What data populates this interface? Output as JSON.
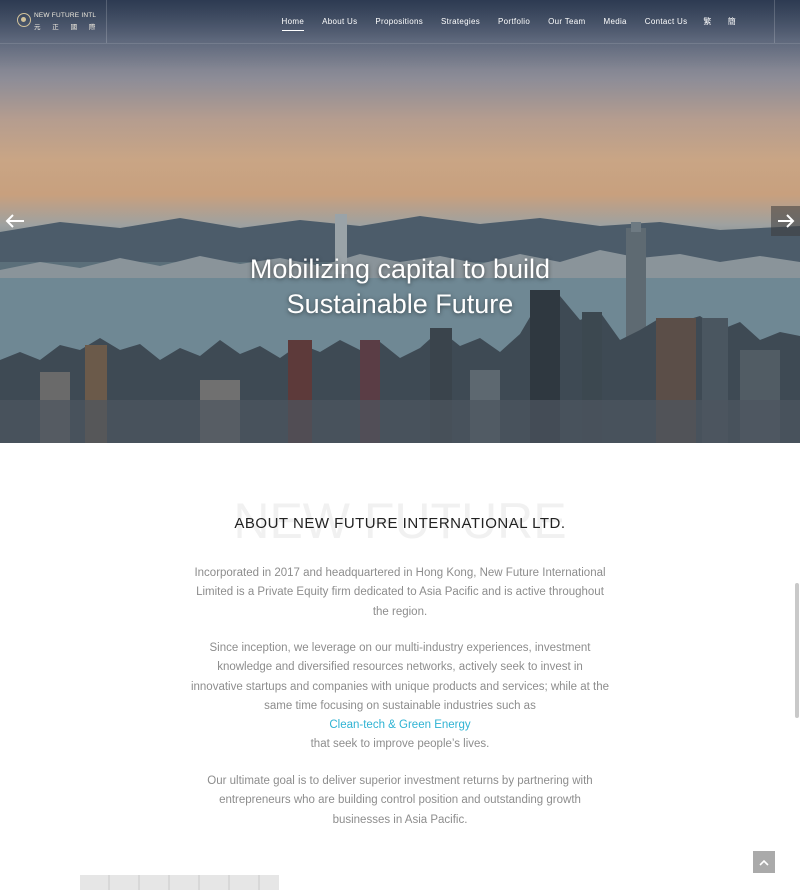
{
  "brand": {
    "name": "NEW FUTURE INTL",
    "name_cn": "元 正 國 際"
  },
  "nav": {
    "items": [
      {
        "label": "Home",
        "active": true
      },
      {
        "label": "About Us"
      },
      {
        "label": "Propositions"
      },
      {
        "label": "Strategies"
      },
      {
        "label": "Portfolio"
      },
      {
        "label": "Our Team"
      },
      {
        "label": "Media"
      },
      {
        "label": "Contact Us"
      },
      {
        "label": "繁"
      },
      {
        "label": "簡"
      }
    ]
  },
  "hero": {
    "title_line1": "Mobilizing capital to build",
    "title_line2": "Sustainable Future",
    "prev_icon": "arrow-left-icon",
    "next_icon": "arrow-right-icon"
  },
  "about": {
    "watermark": "NEW FUTURE",
    "title": "ABOUT NEW FUTURE INTERNATIONAL LTD.",
    "p1": "Incorporated in 2017 and headquartered in Hong Kong, New Future International Limited is a Private Equity firm dedicated to Asia Pacific and is active throughout the region.",
    "p2_a": "Since inception, we leverage on our multi-industry experiences, investment knowledge and diversified resources networks, actively seek to invest in innovative startups and companies with unique products and services; while at the same time focusing on sustainable industries such as",
    "p2_highlight": "Clean-tech & Green Energy",
    "p2_b": "that seek to improve people’s lives.",
    "p3": "Our ultimate goal is to deliver superior investment returns by partnering with entrepreneurs who are building control position and outstanding growth businesses in Asia Pacific."
  },
  "ui": {
    "to_top_icon": "chevron-up-icon",
    "accent": "#2fb3d3"
  }
}
